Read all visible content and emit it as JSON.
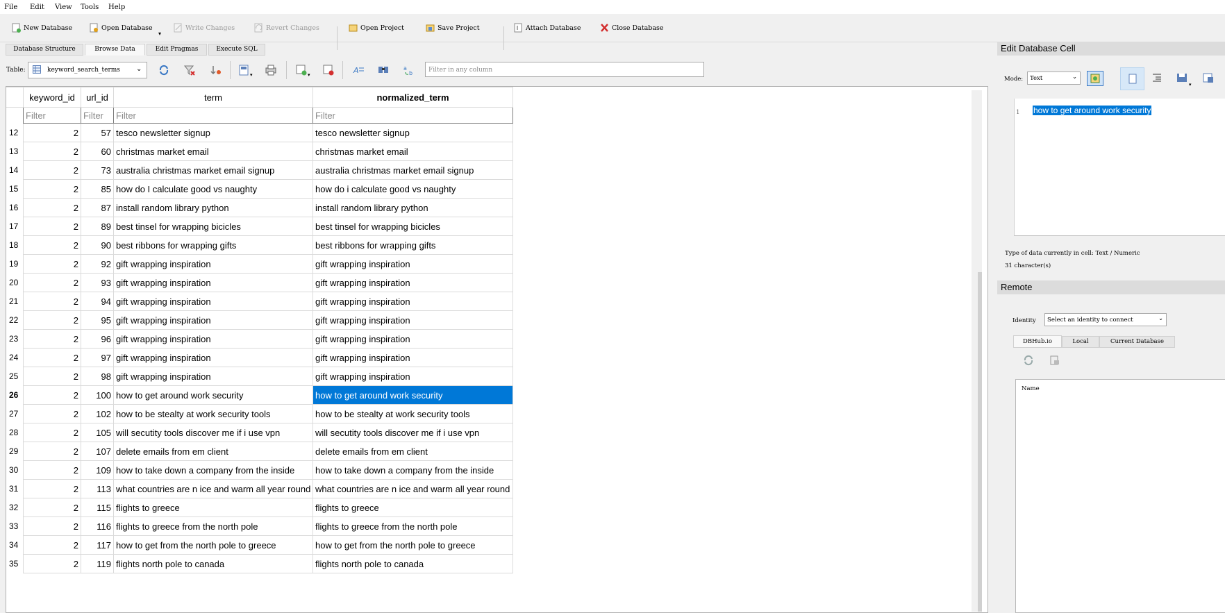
{
  "menu": [
    "File",
    "Edit",
    "View",
    "Tools",
    "Help"
  ],
  "toolbar": {
    "new_db": "New Database",
    "open_db": "Open Database",
    "write": "Write Changes",
    "revert": "Revert Changes",
    "open_project": "Open Project",
    "save_project": "Save Project",
    "attach": "Attach Database",
    "close": "Close Database"
  },
  "tabs": [
    "Database Structure",
    "Browse Data",
    "Edit Pragmas",
    "Execute SQL"
  ],
  "table_bar": {
    "label": "Table:",
    "selected_table": "keyword_search_terms",
    "filter_placeholder": "Filter in any column"
  },
  "grid": {
    "columns": [
      "keyword_id",
      "url_id",
      "term",
      "normalized_term"
    ],
    "filter_placeholder": "Filter",
    "rows": [
      {
        "n": "12",
        "kid": "2",
        "uid": "57",
        "term": "tesco newsletter signup",
        "norm": "tesco newsletter signup"
      },
      {
        "n": "13",
        "kid": "2",
        "uid": "60",
        "term": "christmas market email",
        "norm": "christmas market email"
      },
      {
        "n": "14",
        "kid": "2",
        "uid": "73",
        "term": "australia christmas market email signup",
        "norm": "australia christmas market email signup"
      },
      {
        "n": "15",
        "kid": "2",
        "uid": "85",
        "term": "how do I calculate good vs naughty",
        "norm": "how do i calculate good vs naughty"
      },
      {
        "n": "16",
        "kid": "2",
        "uid": "87",
        "term": "install random library python",
        "norm": "install random library python"
      },
      {
        "n": "17",
        "kid": "2",
        "uid": "89",
        "term": "best tinsel for wrapping bicicles",
        "norm": "best tinsel for wrapping bicicles"
      },
      {
        "n": "18",
        "kid": "2",
        "uid": "90",
        "term": "best ribbons for wrapping gifts",
        "norm": "best ribbons for wrapping gifts"
      },
      {
        "n": "19",
        "kid": "2",
        "uid": "92",
        "term": "gift wrapping inspiration",
        "norm": "gift wrapping inspiration"
      },
      {
        "n": "20",
        "kid": "2",
        "uid": "93",
        "term": "gift wrapping inspiration",
        "norm": "gift wrapping inspiration"
      },
      {
        "n": "21",
        "kid": "2",
        "uid": "94",
        "term": "gift wrapping inspiration",
        "norm": "gift wrapping inspiration"
      },
      {
        "n": "22",
        "kid": "2",
        "uid": "95",
        "term": "gift wrapping inspiration",
        "norm": "gift wrapping inspiration"
      },
      {
        "n": "23",
        "kid": "2",
        "uid": "96",
        "term": "gift wrapping inspiration",
        "norm": "gift wrapping inspiration"
      },
      {
        "n": "24",
        "kid": "2",
        "uid": "97",
        "term": "gift wrapping inspiration",
        "norm": "gift wrapping inspiration"
      },
      {
        "n": "25",
        "kid": "2",
        "uid": "98",
        "term": "gift wrapping inspiration",
        "norm": "gift wrapping inspiration"
      },
      {
        "n": "26",
        "kid": "2",
        "uid": "100",
        "term": "how to get around work security",
        "norm": "how to get around work security",
        "selected": true
      },
      {
        "n": "27",
        "kid": "2",
        "uid": "102",
        "term": "how to be stealty at work security tools",
        "norm": "how to be stealty at work security tools"
      },
      {
        "n": "28",
        "kid": "2",
        "uid": "105",
        "term": "will secutity tools discover me if i use vpn",
        "norm": "will secutity tools discover me if i use vpn"
      },
      {
        "n": "29",
        "kid": "2",
        "uid": "107",
        "term": "delete emails from em client",
        "norm": "delete emails from em client"
      },
      {
        "n": "30",
        "kid": "2",
        "uid": "109",
        "term": "how to take down a company from the inside",
        "norm": "how to take down a company from the inside"
      },
      {
        "n": "31",
        "kid": "2",
        "uid": "113",
        "term": "what countries are n ice and warm all year round",
        "norm": "what countries are n ice and warm all year round"
      },
      {
        "n": "32",
        "kid": "2",
        "uid": "115",
        "term": "flights to greece",
        "norm": "flights to greece"
      },
      {
        "n": "33",
        "kid": "2",
        "uid": "116",
        "term": "flights to greece from the north pole",
        "norm": "flights to greece from the north pole"
      },
      {
        "n": "34",
        "kid": "2",
        "uid": "117",
        "term": "how to get from the north pole to greece",
        "norm": "how to get from the north pole to greece"
      },
      {
        "n": "35",
        "kid": "2",
        "uid": "119",
        "term": "flights north pole to canada",
        "norm": "flights north pole to canada"
      }
    ]
  },
  "edit_cell": {
    "title": "Edit Database Cell",
    "mode_label": "Mode:",
    "mode_value": "Text",
    "line_no": "1",
    "content": "how to get around work security",
    "type_info": "Type of data currently in cell: Text / Numeric",
    "char_count": "31 character(s)"
  },
  "remote": {
    "title": "Remote",
    "identity_label": "Identity",
    "identity_value": "Select an identity to connect",
    "tabs": [
      "DBHub.io",
      "Local",
      "Current Database"
    ],
    "name_header": "Name"
  },
  "colors": {
    "selection": "#0078d7"
  }
}
